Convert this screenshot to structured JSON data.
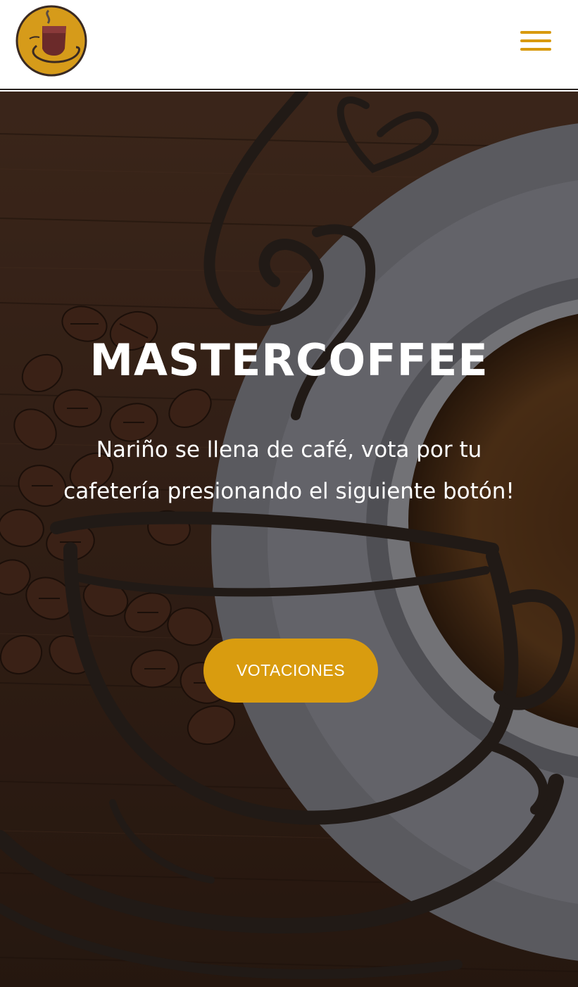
{
  "header": {
    "logo_icon": "coffee-cup-logo-icon",
    "menu_icon": "hamburger-menu-icon",
    "accent_color": "#d89a0e"
  },
  "hero": {
    "title": "MASTERCOFFEE",
    "description": "Nariño se llena de café, vota por tu cafetería presionando el siguiente botón!",
    "button_label": "VOTACIONES",
    "button_color": "#d99c0f"
  }
}
